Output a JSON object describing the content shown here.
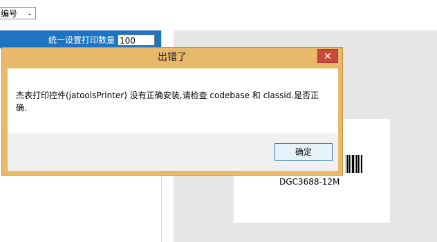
{
  "topbar": {
    "select_value": "编号",
    "select_arrow": "⌄"
  },
  "left_panel": {
    "qty_label": "统一设置打印数量",
    "qty_value": "100"
  },
  "preview": {
    "barcode_text": "DGC3688-12M"
  },
  "dialog": {
    "title": "出错了",
    "close_label": "✕",
    "message": "杰表打印控件(jatoolsPrinter) 没有正确安装,请检查 codebase 和 classid.是否正确.",
    "ok_label": "确定"
  }
}
